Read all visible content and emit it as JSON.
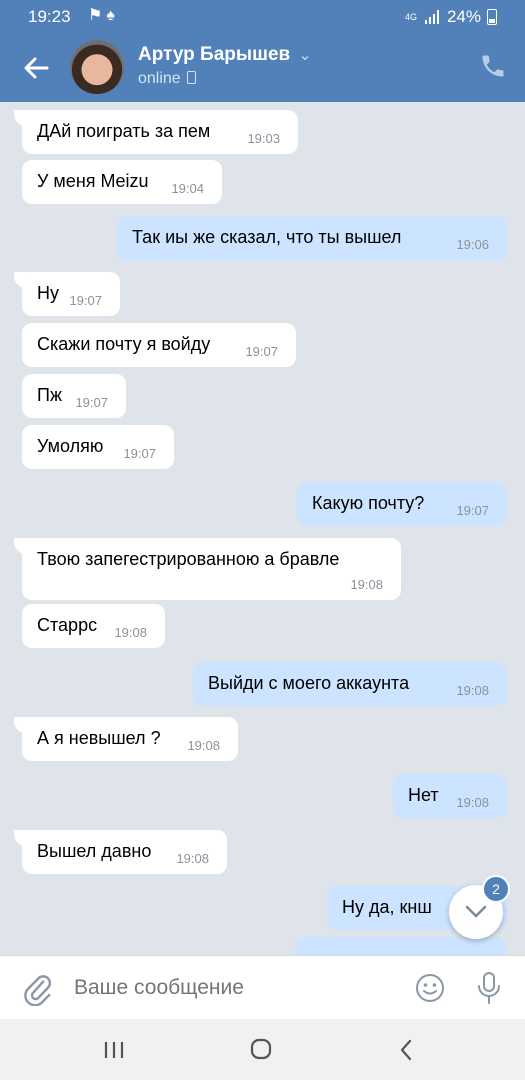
{
  "status_bar": {
    "time": "19:23",
    "network": "4G",
    "battery": "24%"
  },
  "header": {
    "contact_name": "Артур Барышев",
    "status": "online"
  },
  "messages": [
    {
      "dir": "in",
      "text": "ДАй поиграть за пем",
      "time": "19:03"
    },
    {
      "dir": "in",
      "text": "У меня Meizu",
      "time": "19:04"
    },
    {
      "dir": "out",
      "text": "Так иы же сказал, что ты вышел",
      "time": "19:06"
    },
    {
      "dir": "in",
      "text": "Ну",
      "time": "19:07"
    },
    {
      "dir": "in",
      "text": "Скажи почту я войду",
      "time": "19:07"
    },
    {
      "dir": "in",
      "text": "Пж",
      "time": "19:07"
    },
    {
      "dir": "in",
      "text": "Умоляю",
      "time": "19:07"
    },
    {
      "dir": "out",
      "text": "Какую почту?",
      "time": "19:07"
    },
    {
      "dir": "in",
      "text": "Твою запегестрированною а бравле",
      "time": "19:08"
    },
    {
      "dir": "in",
      "text": "Старрс",
      "time": "19:08"
    },
    {
      "dir": "out",
      "text": "Выйди с моего аккаунта",
      "time": "19:08"
    },
    {
      "dir": "in",
      "text": "А я невышел ?",
      "time": "19:08"
    },
    {
      "dir": "out",
      "text": "Нет",
      "time": "19:08"
    },
    {
      "dir": "in",
      "text": "Вышел давно",
      "time": "19:08"
    },
    {
      "dir": "out",
      "text": "Ну да, кнш",
      "time": ""
    }
  ],
  "scroll_down": {
    "unread_count": "2"
  },
  "composer": {
    "placeholder": "Ваше сообщение"
  },
  "colors": {
    "header": "#5181b8",
    "incoming_bubble": "#ffffff",
    "outgoing_bubble": "#cce4ff",
    "chat_background": "#dfe4ea"
  }
}
